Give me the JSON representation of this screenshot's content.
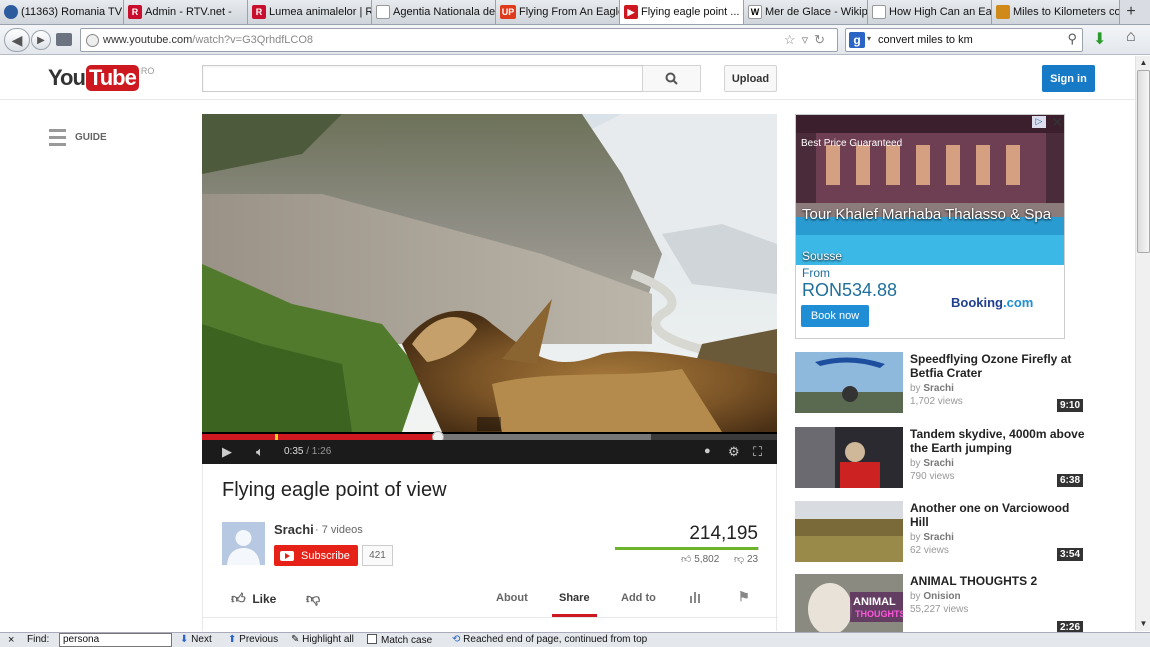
{
  "browser": {
    "tabs": [
      {
        "label": "(11363) Romania TV ...",
        "icon": "globe-icon",
        "color": "#2d5c9e"
      },
      {
        "label": "Admin - RTV.net -",
        "icon": "rtv-icon",
        "color": "#c8102e"
      },
      {
        "label": "Lumea animalelor | R...",
        "icon": "rtv-icon",
        "color": "#c8102e"
      },
      {
        "label": "Agentia Nationala de ...",
        "icon": "blank-page-icon",
        "color": "#cccccc"
      },
      {
        "label": "Flying From An Eagle'...",
        "icon": "up-icon",
        "color": "#e03a1e"
      },
      {
        "label": "Flying eagle point ...",
        "icon": "youtube-icon",
        "color": "#cc181e",
        "active": true
      },
      {
        "label": "Mer de Glace - Wikipe...",
        "icon": "wikipedia-icon",
        "color": "#ffffff"
      },
      {
        "label": "How High Can an Eag...",
        "icon": "blank-page-icon",
        "color": "#cccccc"
      },
      {
        "label": "Miles to Kilometers co...",
        "icon": "calculator-icon",
        "color": "#d08a1a"
      }
    ],
    "new_tab": "+",
    "url_prefix": "www.youtube.com",
    "url_path": "/watch?v=G3QrhdfLCO8",
    "search_value": "convert miles to km"
  },
  "youtube": {
    "logo_you": "You",
    "logo_tube": "Tube",
    "country": "RO",
    "search_placeholder": "",
    "upload": "Upload",
    "sign_in": "Sign in",
    "guide": "GUIDE"
  },
  "player": {
    "current": "0:35",
    "duration": "/ 1:26",
    "played_fraction": 0.41,
    "buffered_fraction": 0.78
  },
  "video": {
    "title": "Flying eagle point of view",
    "channel": "Srachi",
    "channel_videos": "· 7 videos",
    "subscribe": "Subscribe",
    "subscriber_count": "421",
    "views": "214,195",
    "likes": "5,802",
    "dislikes": "23",
    "like_fraction": 0.996,
    "like_label": "Like",
    "tabs": [
      "About",
      "Share",
      "Add to"
    ]
  },
  "ad": {
    "best_price": "Best Price Guaranteed",
    "hotel": "Tour Khalef Marhaba Thalasso & Spa",
    "city": "Sousse",
    "from": "From",
    "price": "RON534.88",
    "book_now": "Book now",
    "brand_main": "Booking",
    "brand_tld": ".com"
  },
  "related": [
    {
      "title": "Speedflying Ozone Firefly at Betfia Crater",
      "by": "by",
      "channel": "Srachi",
      "views": "1,702 views",
      "duration": "9:10"
    },
    {
      "title": "Tandem skydive, 4000m above the Earth jumping",
      "by": "by",
      "channel": "Srachi",
      "views": "790 views",
      "duration": "6:38"
    },
    {
      "title": "Another one on Varciowood Hill",
      "by": "by",
      "channel": "Srachi",
      "views": "62 views",
      "duration": "3:54"
    },
    {
      "title": "ANIMAL THOUGHTS 2",
      "by": "by",
      "channel": "Onision",
      "views": "55,227 views",
      "duration": "2:26"
    }
  ],
  "findbar": {
    "close": "×",
    "find_label": "Find:",
    "find_value": "persona",
    "next": "Next",
    "previous": "Previous",
    "highlight_all": "Highlight all",
    "match_case": "Match case",
    "status": "Reached end of page, continued from top"
  },
  "colors": {
    "youtube_red": "#cc181e",
    "signin_blue": "#167ac6",
    "like_green": "#6bb32a"
  }
}
